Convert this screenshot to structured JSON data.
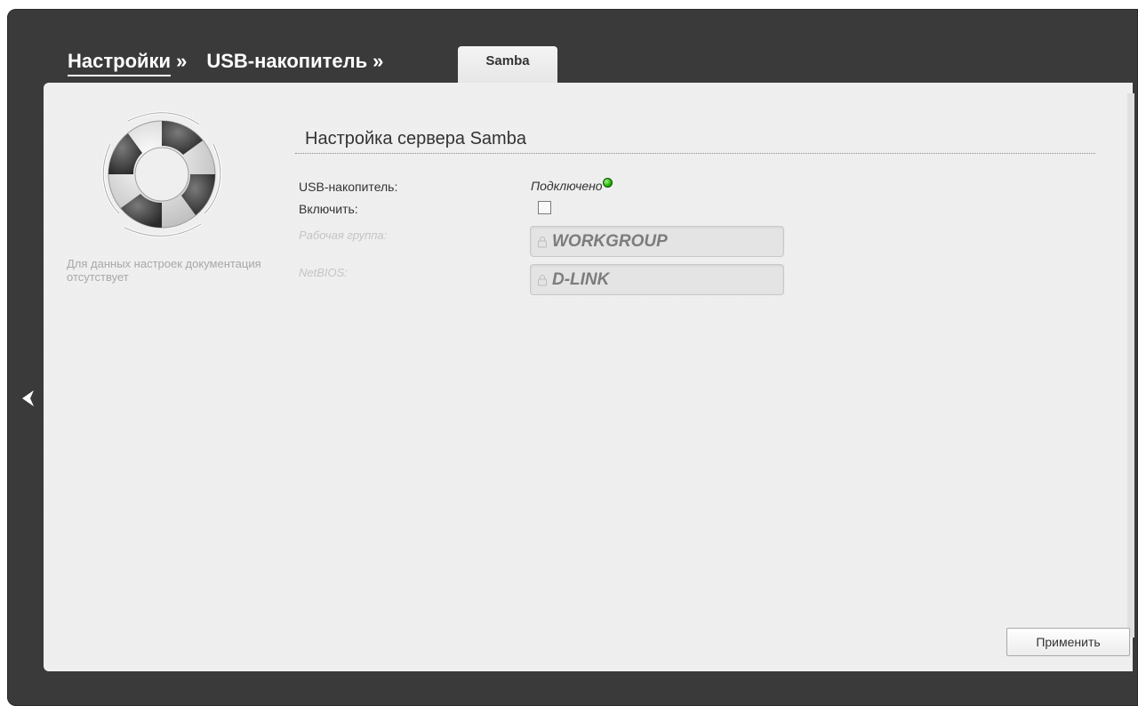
{
  "breadcrumb": {
    "items": [
      {
        "label": "Настройки"
      },
      {
        "label": "USB-накопитель"
      }
    ],
    "separator": "»",
    "active_tab": "Samba"
  },
  "sidebar": {
    "icon": "lifebuoy-icon",
    "doc_note": "Для данных настроек документация отсутствует"
  },
  "section": {
    "title": "Настройка сервера Samba"
  },
  "form": {
    "usb_label": "USB-накопитель:",
    "usb_status": "Подключено",
    "usb_status_color": "#22b000",
    "enable_label": "Включить:",
    "enable_checked": false,
    "workgroup_label": "Рабочая группа:",
    "workgroup_value": "WORKGROUP",
    "netbios_label": "NetBIOS:",
    "netbios_value": "D-LINK"
  },
  "actions": {
    "apply_label": "Применить"
  },
  "colors": {
    "frame": "#3a3a3a",
    "panel": "#efefef"
  }
}
